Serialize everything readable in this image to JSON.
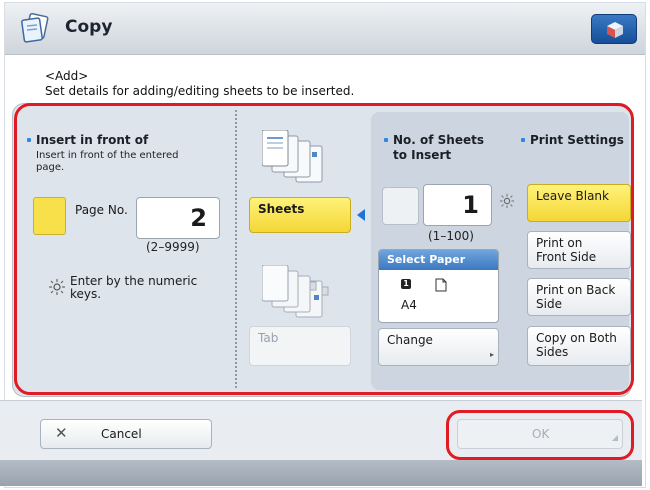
{
  "window": {
    "title": "Copy",
    "icons": {
      "app": "copy-app-icon",
      "corner_button": "counter-check-icon"
    }
  },
  "header": {
    "line1": "<Add>",
    "line2": "Set details for adding/editing sheets to be inserted."
  },
  "left": {
    "heading": "Insert in front of",
    "description_line1": "Insert in front of the entered",
    "description_line2": "page.",
    "page_no_label": "Page No.",
    "page_no_value": "2",
    "page_no_range": "(2–9999)",
    "hint_line1": "Enter by the numeric",
    "hint_line2": "keys."
  },
  "middle": {
    "sheets_label": "Sheets",
    "tab_label": "Tab",
    "selected": "Sheets"
  },
  "sheets_count": {
    "heading_line1": "No. of Sheets",
    "heading_line2": "to Insert",
    "value": "1",
    "range": "(1–100)"
  },
  "select_paper": {
    "header": "Select Paper",
    "size": "A4",
    "tray_badge": "1",
    "change_label": "Change"
  },
  "print_settings": {
    "heading": "Print Settings",
    "options": [
      {
        "line1": "Leave Blank",
        "line2": "",
        "selected": true
      },
      {
        "line1": "Print on",
        "line2": "Front Side",
        "selected": false
      },
      {
        "line1": "Print on Back",
        "line2": "Side",
        "selected": false
      },
      {
        "line1": "Copy on Both",
        "line2": "Sides",
        "selected": false
      }
    ]
  },
  "footer": {
    "cancel_label": "Cancel",
    "ok_label": "OK"
  },
  "colors": {
    "selected_yellow": "#f4d736",
    "highlight_outline": "#e01b24",
    "accent_blue": "#1e73d8"
  }
}
